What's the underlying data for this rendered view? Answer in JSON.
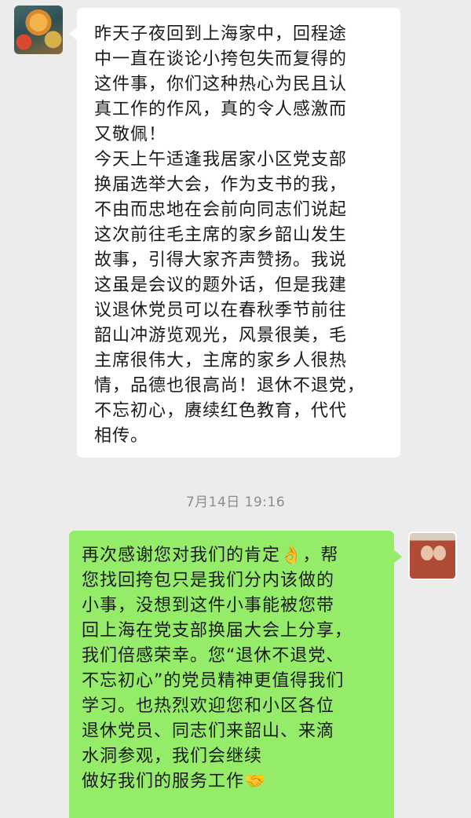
{
  "chat": {
    "incoming_message": {
      "text": "昨天子夜回到上海家中，回程途\n中一直在谈论小挎包失而复得的\n这件事，你们这种热心为民且认\n真工作的作风，真的令人感激而\n又敬佩！\n今天上午适逢我居家小区党支部\n换届选举大会，作为支书的我，\n不由而忠地在会前向同志们说起\n这次前往毛主席的家乡韶山发生\n故事，引得大家齐声赞扬。我说\n这虽是会议的题外话，但是我建\n议退休党员可以在春秋季节前往\n韶山冲游览观光，风景很美，毛\n主席很伟大，主席的家乡人很热\n情，品德也很高尚！退休不退党，\n不忘初心，赓续红色教育，代代\n相传。"
    },
    "timestamp": "7月14日 19:16",
    "outgoing_message": {
      "text": "再次感谢您对我们的肯定👌，帮\n您找回挎包只是我们分内该做的\n小事，没想到这件小事能被您带\n回上海在党支部换届大会上分享，\n我们倍感荣幸。您“退休不退党、\n不忘初心”的党员精神更值得我们\n学习。也热烈欢迎您和小区各位\n退休党员、同志们来韶山、来滴\n水洞参观，我们会继续\n做好我们的服务工作🤝"
    }
  }
}
